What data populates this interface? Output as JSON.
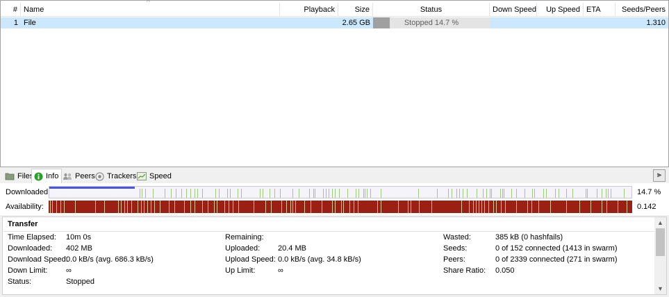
{
  "columns": {
    "num": "#",
    "name": "Name",
    "playback": "Playback",
    "size": "Size",
    "status": "Status",
    "down_speed": "Down Speed",
    "up_speed": "Up Speed",
    "eta": "ETA",
    "seeds_peers": "Seeds/Peers"
  },
  "torrent": {
    "num": "1",
    "name": "File",
    "playback": "",
    "size": "2.65 GB",
    "status": "Stopped 14.7 %",
    "progress_fraction": 0.147,
    "down_speed": "",
    "up_speed": "",
    "eta": "",
    "seeds_peers": "1.310"
  },
  "tabs": [
    {
      "label": "Files",
      "icon": "folder-icon"
    },
    {
      "label": "Info",
      "icon": "info-icon"
    },
    {
      "label": "Peers",
      "icon": "peers-icon"
    },
    {
      "label": "Trackers",
      "icon": "tracker-icon"
    },
    {
      "label": "Speed",
      "icon": "graph-icon"
    }
  ],
  "active_tab": "Info",
  "pieces": {
    "downloaded_label": "Downloaded:",
    "downloaded_value": "14.7 %",
    "downloaded_fraction": 0.147,
    "availability_label": "Availability:",
    "availability_value": "0.142"
  },
  "transfer": {
    "title": "Transfer",
    "col1": [
      {
        "label": "Time Elapsed:",
        "value": "10m 0s"
      },
      {
        "label": "Downloaded:",
        "value": "402 MB"
      },
      {
        "label": "Download Speed:",
        "value": "0.0 kB/s (avg. 686.3 kB/s)"
      },
      {
        "label": "Down Limit:",
        "value": "∞"
      },
      {
        "label": "Status:",
        "value": "Stopped"
      }
    ],
    "col2": [
      {
        "label": "Remaining:",
        "value": ""
      },
      {
        "label": "Uploaded:",
        "value": "20.4 MB"
      },
      {
        "label": "Upload Speed:",
        "value": "0.0 kB/s (avg. 34.8 kB/s)"
      },
      {
        "label": "Up Limit:",
        "value": "∞"
      }
    ],
    "col3": [
      {
        "label": "Wasted:",
        "value": "385 kB (0 hashfails)"
      },
      {
        "label": "Seeds:",
        "value": "0 of 152 connected (1413 in swarm)"
      },
      {
        "label": "Peers:",
        "value": "0 of 2339 connected (271 in swarm)"
      },
      {
        "label": "Share Ratio:",
        "value": "0.050"
      }
    ]
  },
  "colors": {
    "selection": "#cce8ff",
    "progress_blue": "#4a56e0",
    "piece_green": "#9ccc7a",
    "availability_red": "#9c1f14",
    "availability_tan": "#d8c89a"
  }
}
